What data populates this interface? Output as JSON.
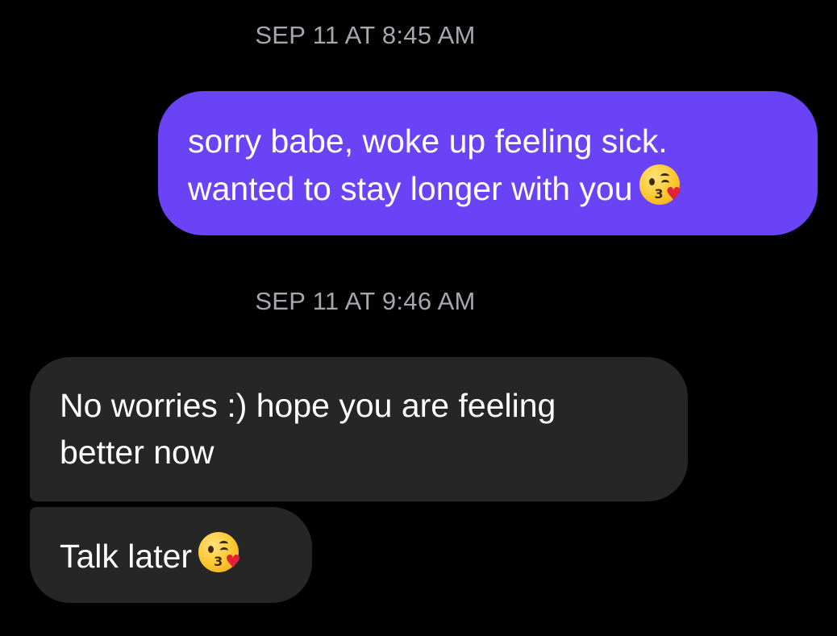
{
  "thread": {
    "timestamps": [
      "SEP 11 AT 8:45 AM",
      "SEP 11 AT 9:46 AM"
    ],
    "messages": [
      {
        "direction": "outgoing",
        "lines": [
          "sorry babe, woke up feeling sick.",
          "wanted to stay longer with you"
        ],
        "trailing_emoji": "face-blowing-a-kiss"
      },
      {
        "direction": "incoming",
        "lines": [
          "No worries :) hope you are feeling",
          "better now"
        ]
      },
      {
        "direction": "incoming",
        "lines": [
          "Talk later"
        ],
        "trailing_emoji": "face-blowing-a-kiss"
      }
    ]
  },
  "emoji_glyphs": {
    "mouth": "3",
    "heart": "♥"
  },
  "colors": {
    "background": "#000000",
    "outgoing_bubble": "#6a43f7",
    "incoming_bubble": "#262626",
    "timestamp_text": "#a6a6ab",
    "message_text": "#ffffff"
  }
}
